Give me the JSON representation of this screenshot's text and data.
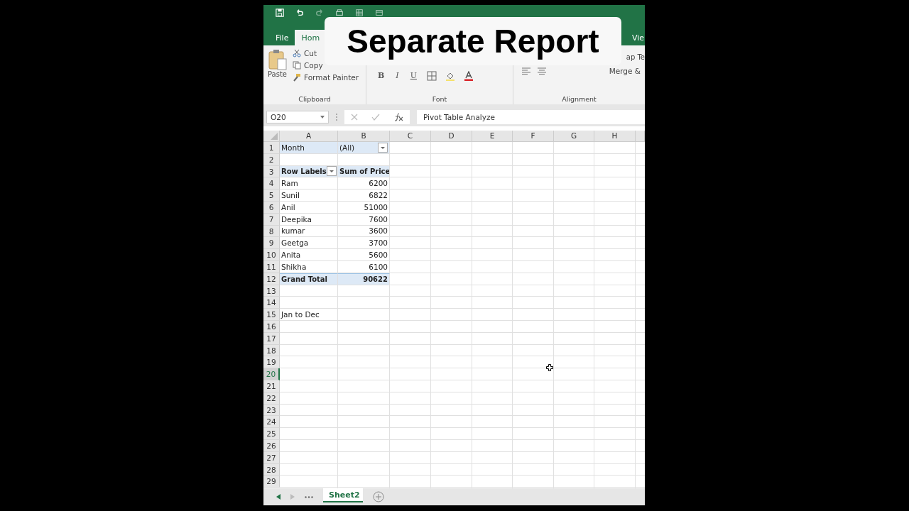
{
  "tabs": [
    {
      "label": "File",
      "selected": false
    },
    {
      "label": "Hom",
      "selected": true
    },
    {
      "label": "Vie",
      "selected": false
    }
  ],
  "caption": "Separate Report",
  "ribbon": {
    "groups": [
      {
        "kind": "clipboard",
        "label": "Clipboard",
        "paste": "Paste",
        "items": [
          "Cut",
          "Copy",
          "Format Painter"
        ]
      },
      {
        "kind": "font",
        "label": "Font",
        "buttons": [
          "B",
          "I",
          "U"
        ]
      },
      {
        "kind": "alignment",
        "label": "Alignment",
        "items": [
          "ap Te",
          "Merge &"
        ]
      }
    ]
  },
  "formula_bar": {
    "name_box": "O20",
    "formula": "Pivot Table Analyze"
  },
  "sheet": {
    "columns": [
      "A",
      "B",
      "C",
      "D",
      "E",
      "F",
      "G",
      "H"
    ],
    "rows": [
      {
        "number": "1",
        "selected": false,
        "kind": "filter",
        "cells": [
          {
            "text": "Month"
          },
          {
            "text": "(All)",
            "dropdown": true
          }
        ]
      },
      {
        "number": "2",
        "selected": false
      },
      {
        "number": "3",
        "selected": false,
        "kind": "header",
        "cells": [
          {
            "text": "Row Labels",
            "dropdown": true
          },
          {
            "text": "Sum of Price"
          }
        ]
      },
      {
        "number": "4",
        "selected": false,
        "kind": "item",
        "cells": [
          {
            "text": "Ram"
          },
          {
            "text": "6200"
          }
        ]
      },
      {
        "number": "5",
        "selected": false,
        "kind": "item",
        "cells": [
          {
            "text": "Sunil"
          },
          {
            "text": "6822"
          }
        ]
      },
      {
        "number": "6",
        "selected": false,
        "kind": "item",
        "cells": [
          {
            "text": "Anil"
          },
          {
            "text": "51000"
          }
        ]
      },
      {
        "number": "7",
        "selected": false,
        "kind": "item",
        "cells": [
          {
            "text": "Deepika"
          },
          {
            "text": "7600"
          }
        ]
      },
      {
        "number": "8",
        "selected": false,
        "kind": "item",
        "cells": [
          {
            "text": "kumar"
          },
          {
            "text": "3600"
          }
        ]
      },
      {
        "number": "9",
        "selected": false,
        "kind": "item",
        "cells": [
          {
            "text": "Geetga"
          },
          {
            "text": "3700"
          }
        ]
      },
      {
        "number": "10",
        "selected": false,
        "kind": "item",
        "cells": [
          {
            "text": "Anita"
          },
          {
            "text": "5600"
          }
        ]
      },
      {
        "number": "11",
        "selected": false,
        "kind": "item",
        "cells": [
          {
            "text": "Shikha"
          },
          {
            "text": "6100"
          }
        ]
      },
      {
        "number": "12",
        "selected": false,
        "kind": "total",
        "cells": [
          {
            "text": "Grand Total"
          },
          {
            "text": "90622"
          }
        ]
      },
      {
        "number": "13",
        "selected": false
      },
      {
        "number": "14",
        "selected": false
      },
      {
        "number": "15",
        "selected": false,
        "kind": "plain",
        "cells": [
          {
            "text": "Jan to Dec"
          }
        ]
      },
      {
        "number": "16",
        "selected": false
      },
      {
        "number": "17",
        "selected": false
      },
      {
        "number": "18",
        "selected": false
      },
      {
        "number": "19",
        "selected": false
      },
      {
        "number": "20",
        "selected": true
      },
      {
        "number": "21",
        "selected": false
      },
      {
        "number": "22",
        "selected": false
      },
      {
        "number": "23",
        "selected": false
      },
      {
        "number": "24",
        "selected": false
      },
      {
        "number": "25",
        "selected": false
      },
      {
        "number": "26",
        "selected": false
      },
      {
        "number": "27",
        "selected": false
      },
      {
        "number": "28",
        "selected": false
      },
      {
        "number": "29",
        "selected": false
      }
    ]
  },
  "sheet_tabs": [
    {
      "label": "Sheet2",
      "selected": true
    }
  ]
}
